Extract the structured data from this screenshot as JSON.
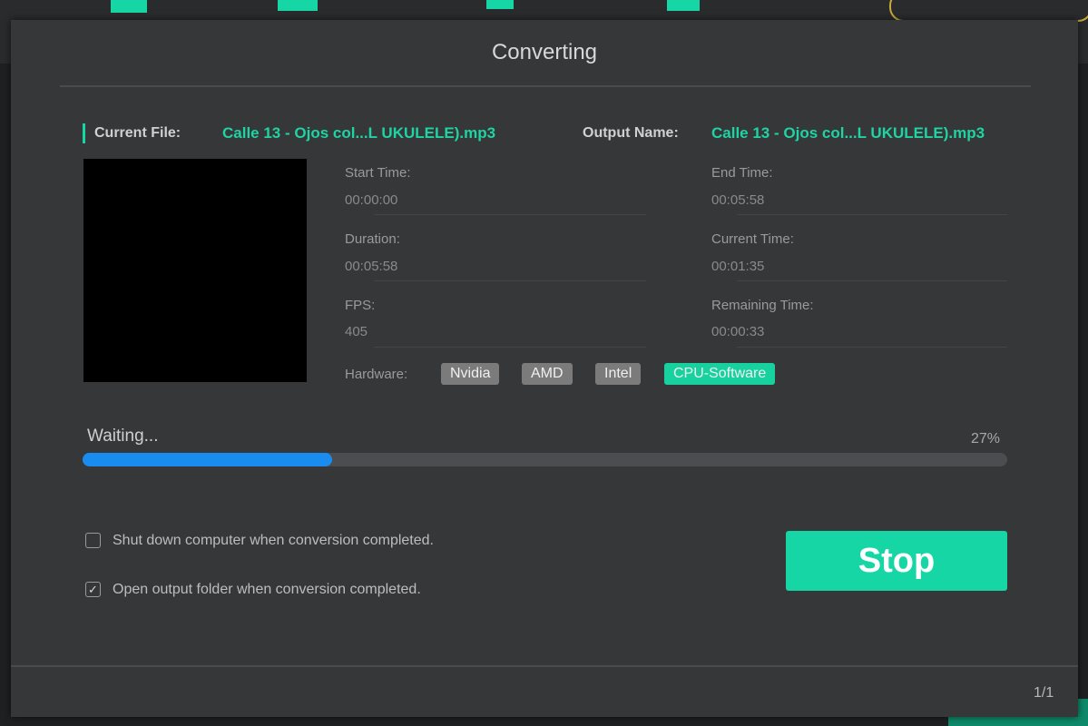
{
  "dialog": {
    "title": "Converting",
    "page_indicator": "1/1"
  },
  "file": {
    "current_label": "Current File:",
    "current_name": "Calle 13 - Ojos col...L UKULELE).mp3",
    "output_label": "Output Name:",
    "output_name": "Calle 13 - Ojos col...L UKULELE).mp3"
  },
  "info": {
    "start_label": "Start Time:",
    "start_value": "00:00:00",
    "end_label": "End Time:",
    "end_value": "00:05:58",
    "duration_label": "Duration:",
    "duration_value": "00:05:58",
    "current_label": "Current Time:",
    "current_value": "00:01:35",
    "fps_label": "FPS:",
    "fps_value": "405",
    "remaining_label": "Remaining Time:",
    "remaining_value": "00:00:33"
  },
  "hardware": {
    "label": "Hardware:",
    "options": [
      "Nvidia",
      "AMD",
      "Intel",
      "CPU-Software"
    ],
    "selected": "CPU-Software"
  },
  "progress": {
    "status": "Waiting...",
    "percent_label": "27%",
    "percent": 27
  },
  "options": {
    "shutdown_label": "Shut down computer when conversion completed.",
    "shutdown_checked": false,
    "open_folder_label": "Open output folder when conversion completed.",
    "open_folder_checked": true,
    "check_glyph": "✓"
  },
  "stop_label": "Stop",
  "colors": {
    "accent": "#17d6a6",
    "progress": "#1a8cf0"
  }
}
